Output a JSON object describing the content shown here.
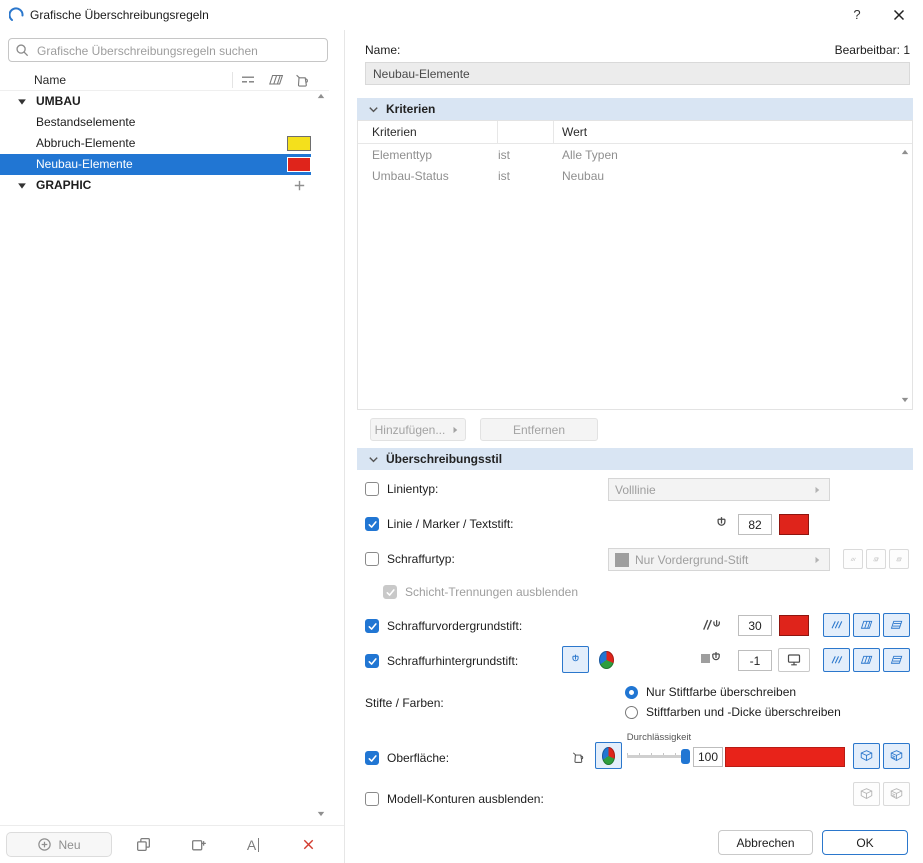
{
  "window": {
    "title": "Grafische Überschreibungsregeln",
    "help": "?"
  },
  "left": {
    "search": {
      "placeholder": "Grafische Überschreibungsregeln suchen"
    },
    "header": {
      "name": "Name"
    },
    "tree": {
      "group1": "UMBAU",
      "item1": "Bestandselemente",
      "item2": "Abbruch-Elemente",
      "item3": "Neubau-Elemente",
      "group2": "GRAPHIC"
    },
    "footer": {
      "new": "Neu"
    }
  },
  "right": {
    "name_label": "Name:",
    "editable": "Bearbeitbar: 1",
    "name_value": "Neubau-Elemente",
    "criteria": {
      "title": "Kriterien",
      "col_name": "Kriterien",
      "col_value": "Wert",
      "rows": [
        {
          "name": "Elementtyp",
          "op": "ist",
          "value": "Alle Typen"
        },
        {
          "name": "Umbau-Status",
          "op": "ist",
          "value": "Neubau"
        }
      ],
      "add": "Hinzufügen...",
      "remove": "Entfernen"
    },
    "style": {
      "title": "Überschreibungsstil",
      "linetype_label": "Linientyp:",
      "linetype_value": "Volllinie",
      "linepen_label": "Linie / Marker / Textstift:",
      "linepen_value": "82",
      "filltype_label": "Schraffurtyp:",
      "filltype_value": "Nur Vordergrund-Stift",
      "separators_label": "Schicht-Trennungen ausblenden",
      "fgpen_label": "Schraffurvordergrundstift:",
      "fgpen_value": "30",
      "bgpen_label": "Schraffurhintergrundstift:",
      "bgpen_value": "-1",
      "pens_label": "Stifte / Farben:",
      "radio_color_only": "Nur Stiftfarbe überschreiben",
      "radio_color_weight": "Stiftfarben und -Dicke überschreiben",
      "surface_label": "Oberfläche:",
      "transparency_label": "Durchlässigkeit",
      "transparency_value": "100",
      "outlines_label": "Modell-Konturen ausblenden:"
    },
    "footer": {
      "cancel": "Abbrechen",
      "ok": "OK"
    },
    "colors": {
      "accent": "#2176d3",
      "red": "#df241b",
      "yellow": "#f4e01c"
    }
  }
}
